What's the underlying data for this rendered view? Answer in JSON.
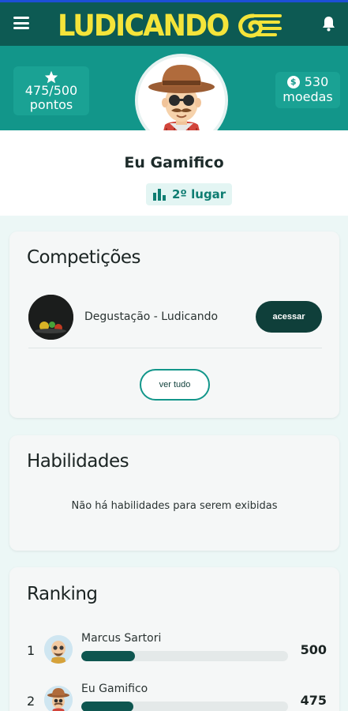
{
  "header": {
    "logo_text": "LUDICANDO",
    "menu_icon": "hamburger-icon",
    "bell_icon": "bell-icon"
  },
  "stats": {
    "points_value": "475/500",
    "points_label": "pontos",
    "coins_value": "530",
    "coins_label": "moedas",
    "coin_symbol": "$"
  },
  "profile": {
    "name": "Eu Gamifico",
    "rank_label": "2º lugar"
  },
  "competitions": {
    "title": "Competições",
    "items": [
      {
        "name": "Degustação - Ludicando",
        "button": "acessar"
      }
    ],
    "see_all": "ver tudo"
  },
  "skills": {
    "title": "Habilidades",
    "empty_message": "Não há habilidades para serem exibidas"
  },
  "ranking": {
    "title": "Ranking",
    "max_points": 500,
    "rows": [
      {
        "position": "1",
        "name": "Marcus Sartori",
        "points": "500",
        "progress": 0.26
      },
      {
        "position": "2",
        "name": "Eu Gamifico",
        "points": "475",
        "progress": 0.25
      }
    ]
  },
  "colors": {
    "header_bg": "#0d5a53",
    "banner_bg": "#12968a",
    "accent_dark": "#0f3f3a",
    "logo_yellow": "#f4e43a"
  }
}
